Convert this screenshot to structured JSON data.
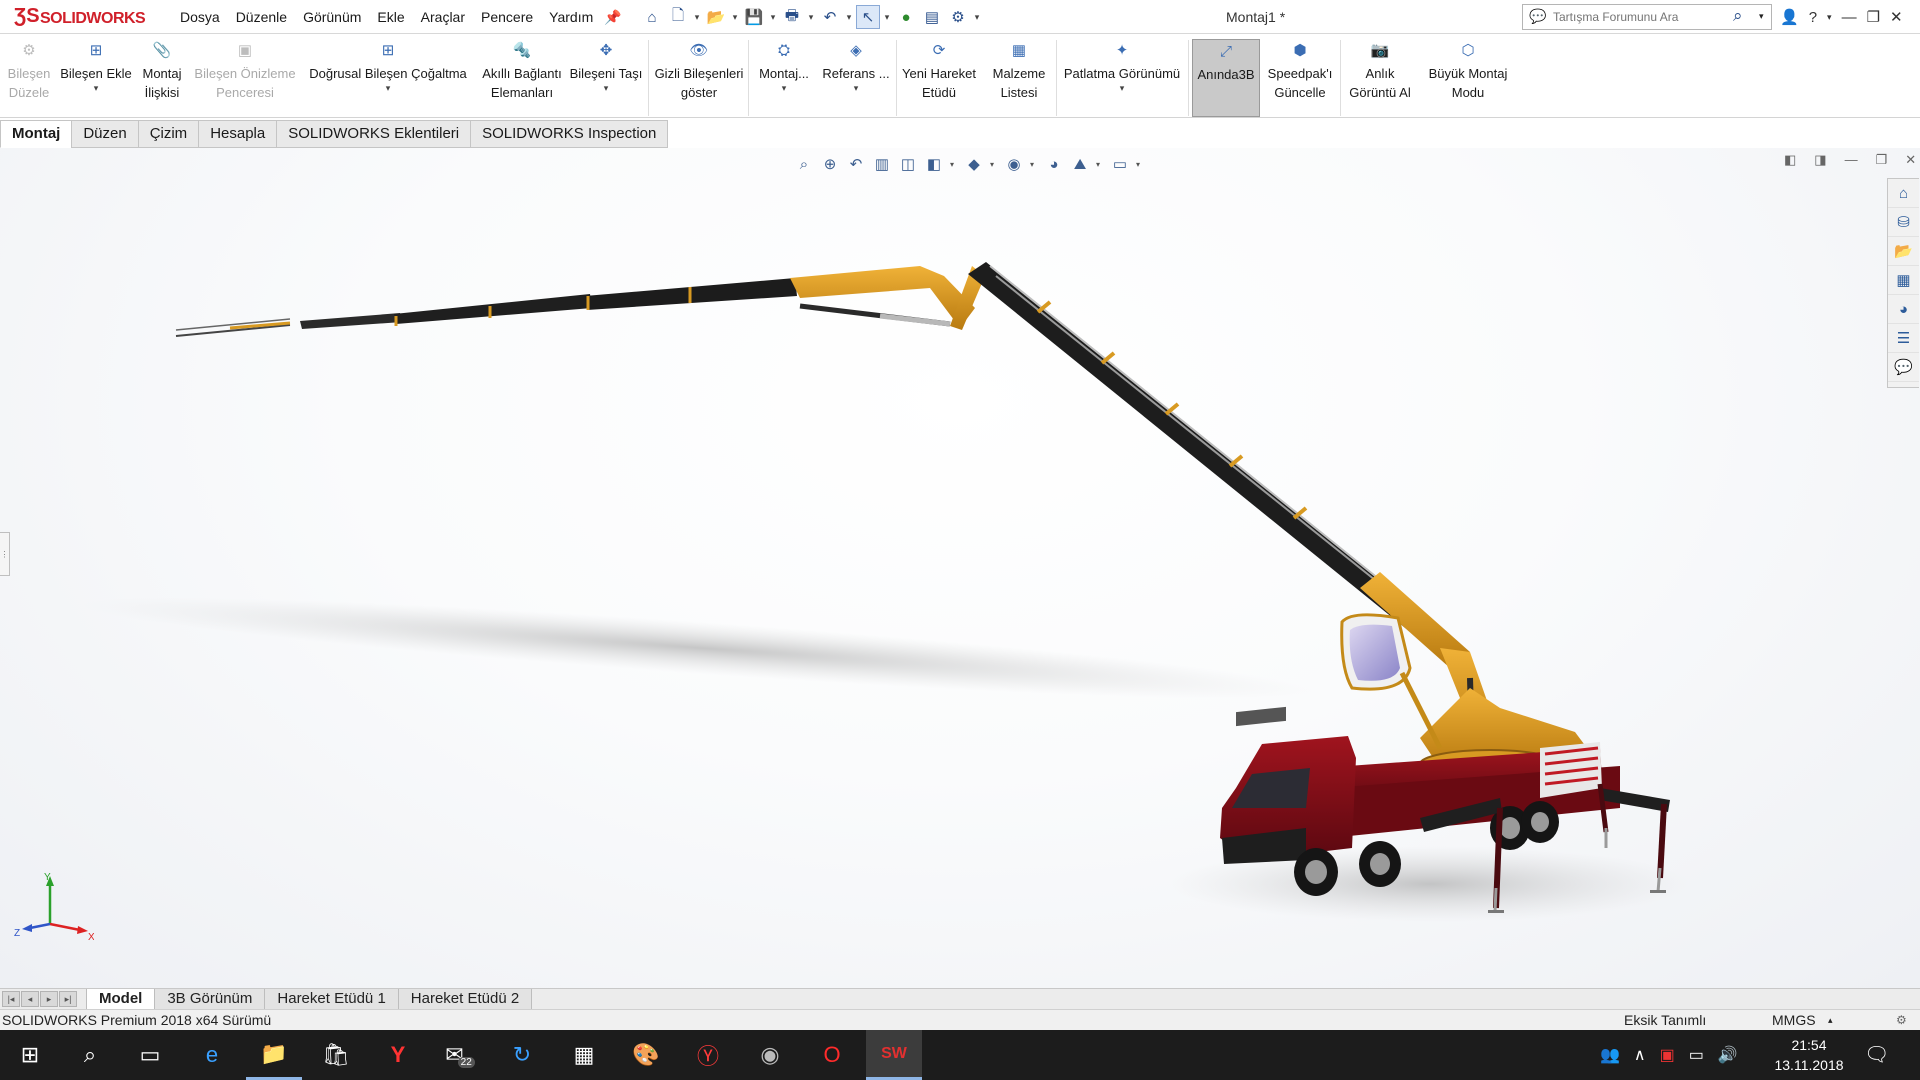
{
  "app": {
    "logo_text": "SOLIDWORKS",
    "logo_mark": "ƷS",
    "document_title": "Montaj1 *"
  },
  "menu": [
    "Dosya",
    "Düzenle",
    "Görünüm",
    "Ekle",
    "Araçlar",
    "Pencere",
    "Yardım"
  ],
  "search": {
    "placeholder": "Tartışma Forumunu Ara"
  },
  "ribbon": {
    "b1": "Bileşen Düzele",
    "b2": "Bileşen Ekle",
    "b3": "Montaj İlişkisi",
    "b4": "Bileşen Önizleme Penceresi",
    "b5": "Doğrusal Bileşen Çoğaltma",
    "b6": "Akıllı Bağlantı Elemanları",
    "b7": "Bileşeni Taşı",
    "b8": "Gizli Bileşenleri göster",
    "b9": "Montaj...",
    "b10": "Referans ...",
    "b11": "Yeni Hareket Etüdü",
    "b12": "Malzeme Listesi",
    "b13": "Patlatma Görünümü",
    "b14": "Anında3B",
    "b15": "Speedpak'ı Güncelle",
    "b16": "Anlık Görüntü Al",
    "b17": "Büyük Montaj Modu"
  },
  "tabs": [
    "Montaj",
    "Düzen",
    "Çizim",
    "Hesapla",
    "SOLIDWORKS Eklentileri",
    "SOLIDWORKS Inspection"
  ],
  "bottom_tabs": [
    "Model",
    "3B Görünüm",
    "Hareket Etüdü 1",
    "Hareket Etüdü 2"
  ],
  "status": {
    "version": "SOLIDWORKS Premium 2018 x64 Sürümü",
    "state": "Eksik Tanımlı",
    "units": "MMGS"
  },
  "triad": {
    "x": "X",
    "y": "Y",
    "z": "Z"
  },
  "taskbar": {
    "time": "21:54",
    "date": "13.11.2018",
    "mail_badge": "22"
  },
  "colors": {
    "accent": "#d0202a",
    "boom_orange": "#d89a22",
    "truck_red": "#7a0c14",
    "boom_black": "#1f1f1f"
  }
}
